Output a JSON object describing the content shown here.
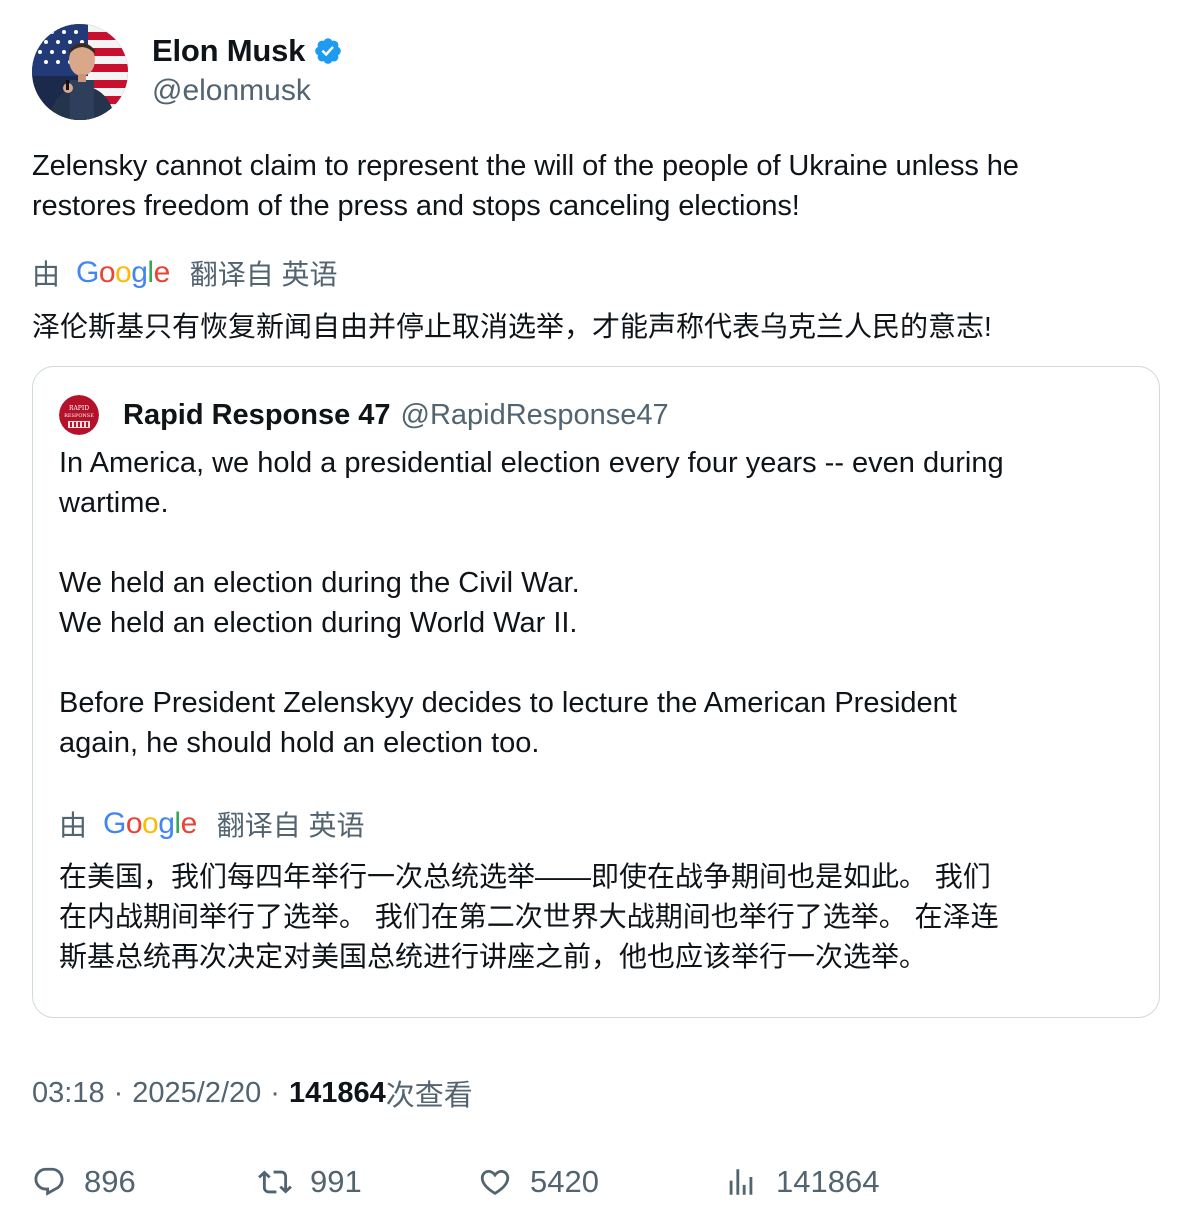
{
  "author": {
    "display_name": "Elon Musk",
    "handle": "@elonmusk"
  },
  "tweet": {
    "text_line1": "Zelensky cannot claim to represent the will of the people of Ukraine unless he",
    "text_line2": "restores freedom of the press and stops canceling elections!",
    "translate_by": "由",
    "translate_brand": "Google",
    "translate_from": "翻译自 英语",
    "translation": "泽伦斯基只有恢复新闻自由并停止取消选举，才能声称代表乌克兰人民的意志!"
  },
  "quote": {
    "avatar_text_line1": "RAPID",
    "avatar_text_line2": "RESPONSE",
    "display_name": "Rapid Response 47",
    "handle": "@RapidResponse47",
    "lines": [
      "In America, we hold a presidential election every four years -- even during",
      "wartime.",
      "We held an election during the Civil War.",
      "We held an election during World War II.",
      "Before President Zelenskyy decides to lecture the American President",
      "again, he should hold an election too."
    ],
    "translate_by": "由",
    "translate_brand": "Google",
    "translate_from": "翻译自 英语",
    "translation_lines": [
      "在美国，我们每四年举行一次总统选举——即使在战争期间也是如此。 我们",
      "在内战期间举行了选举。 我们在第二次世界大战期间也举行了选举。 在泽连",
      "斯基总统再次决定对美国总统进行讲座之前，他也应该举行一次选举。"
    ]
  },
  "meta": {
    "time": "03:18",
    "separator": "·",
    "date": "2025/2/20",
    "views_count": "141864",
    "views_label": "次查看"
  },
  "actions": {
    "replies": "896",
    "retweets": "991",
    "likes": "5420",
    "views": "141864"
  },
  "colors": {
    "text_primary": "#0f1419",
    "text_secondary": "#536471",
    "border": "#cfd9de",
    "verified_blue": "#1d9bf0",
    "google_blue": "#4285f4",
    "google_red": "#ea4335",
    "google_yellow": "#fbbc05",
    "google_green": "#34a853"
  },
  "icons": {
    "verified": "verified-badge-icon",
    "reply": "speech-bubble-icon",
    "retweet": "retweet-arrows-icon",
    "like": "heart-icon",
    "views": "bar-chart-icon"
  }
}
